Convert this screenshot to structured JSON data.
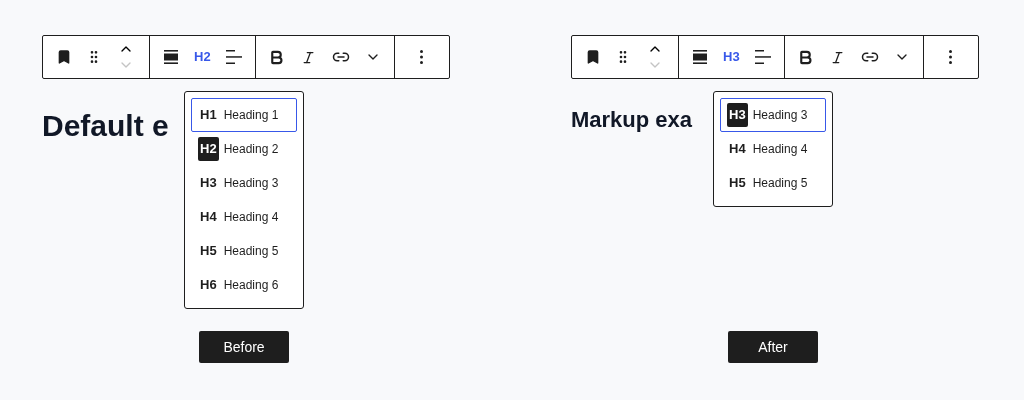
{
  "panels": [
    {
      "toolbar": {
        "heading_level": "H2",
        "move_down_disabled": true
      },
      "heading": "Default e",
      "menu": [
        {
          "tag": "H1",
          "label": "Heading 1",
          "current": false,
          "focused": true
        },
        {
          "tag": "H2",
          "label": "Heading 2",
          "current": true,
          "focused": false
        },
        {
          "tag": "H3",
          "label": "Heading 3",
          "current": false,
          "focused": false
        },
        {
          "tag": "H4",
          "label": "Heading 4",
          "current": false,
          "focused": false
        },
        {
          "tag": "H5",
          "label": "Heading 5",
          "current": false,
          "focused": false
        },
        {
          "tag": "H6",
          "label": "Heading 6",
          "current": false,
          "focused": false
        }
      ],
      "button": "Before"
    },
    {
      "toolbar": {
        "heading_level": "H3",
        "move_down_disabled": true
      },
      "heading": "Markup exa",
      "menu": [
        {
          "tag": "H3",
          "label": "Heading 3",
          "current": true,
          "focused": true
        },
        {
          "tag": "H4",
          "label": "Heading 4",
          "current": false,
          "focused": false
        },
        {
          "tag": "H5",
          "label": "Heading 5",
          "current": false,
          "focused": false
        }
      ],
      "button": "After"
    }
  ]
}
